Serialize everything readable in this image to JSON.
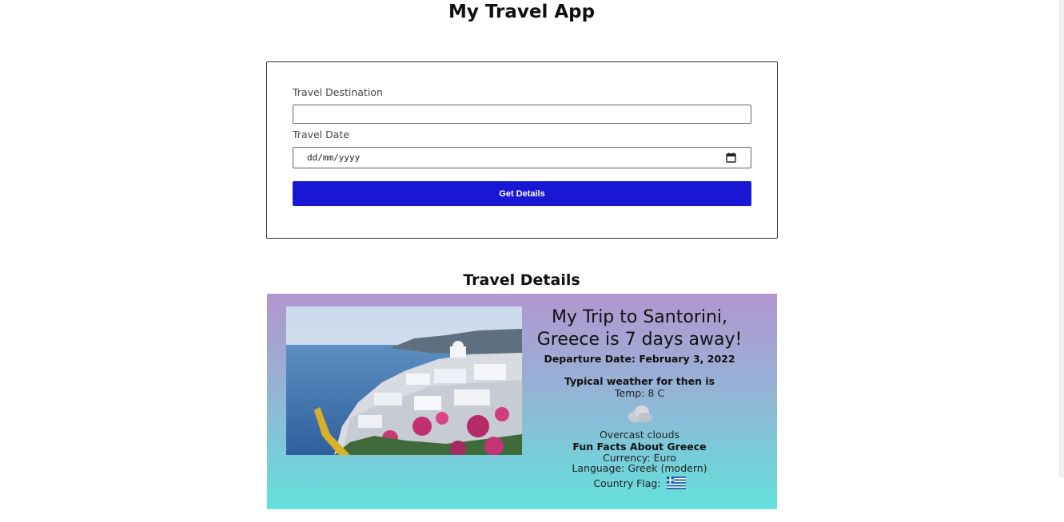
{
  "app": {
    "title": "My Travel App"
  },
  "form": {
    "destination_label": "Travel Destination",
    "destination_value": "",
    "date_label": "Travel Date",
    "date_placeholder": "dd/mm/yyyy",
    "submit_label": "Get Details"
  },
  "details": {
    "section_title": "Travel Details",
    "heading_line1": "My Trip to Santorini,",
    "heading_line2": "Greece is 7 days away!",
    "departure": "Departure Date: February 3, 2022",
    "weather_heading": "Typical weather for then is",
    "temp": "Temp: 8 C",
    "weather_icon": "cloud-icon",
    "weather_desc": "Overcast clouds",
    "facts_heading": "Fun Facts About Greece",
    "currency_label": "Currency:",
    "currency_value": "Euro",
    "language_label": "Language:",
    "language_value": "Greek (modern)",
    "flag_label": "Country Flag:",
    "flag_icon": "greece-flag-icon"
  },
  "colors": {
    "button": "#1717d4",
    "gradient_top": "#b396cf",
    "gradient_bottom": "#62e1dc"
  }
}
